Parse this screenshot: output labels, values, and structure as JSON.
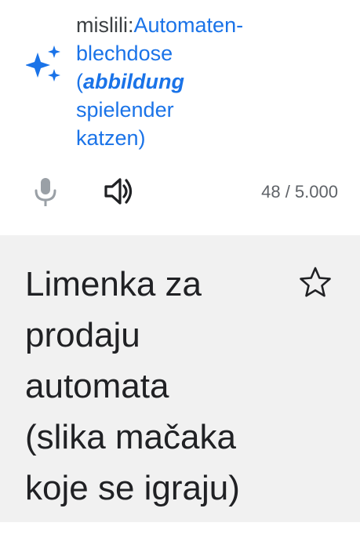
{
  "source": {
    "cut_top_text": "",
    "did_you_mean_prefix": "mislili:",
    "line1": "Automaten-",
    "line2": "blechdose",
    "line3_paren": "(",
    "line3_italic": "abbildung",
    "line4": "spielender",
    "line5": "katzen)",
    "char_counter": "48 / 5.000",
    "icons": [
      "sparkle-icon",
      "microphone-icon",
      "speaker-icon"
    ]
  },
  "translation": {
    "lines": [
      "Limenka za",
      "prodaju",
      "automata",
      "(slika mačaka",
      "koje se igraju)"
    ],
    "icons": [
      "star-icon"
    ]
  },
  "colors": {
    "accent": "#1a73e8",
    "text_primary": "#202124",
    "text_secondary": "#5f6368",
    "icon_disabled": "#9aa0a6",
    "result_background": "#f1f1f1"
  }
}
